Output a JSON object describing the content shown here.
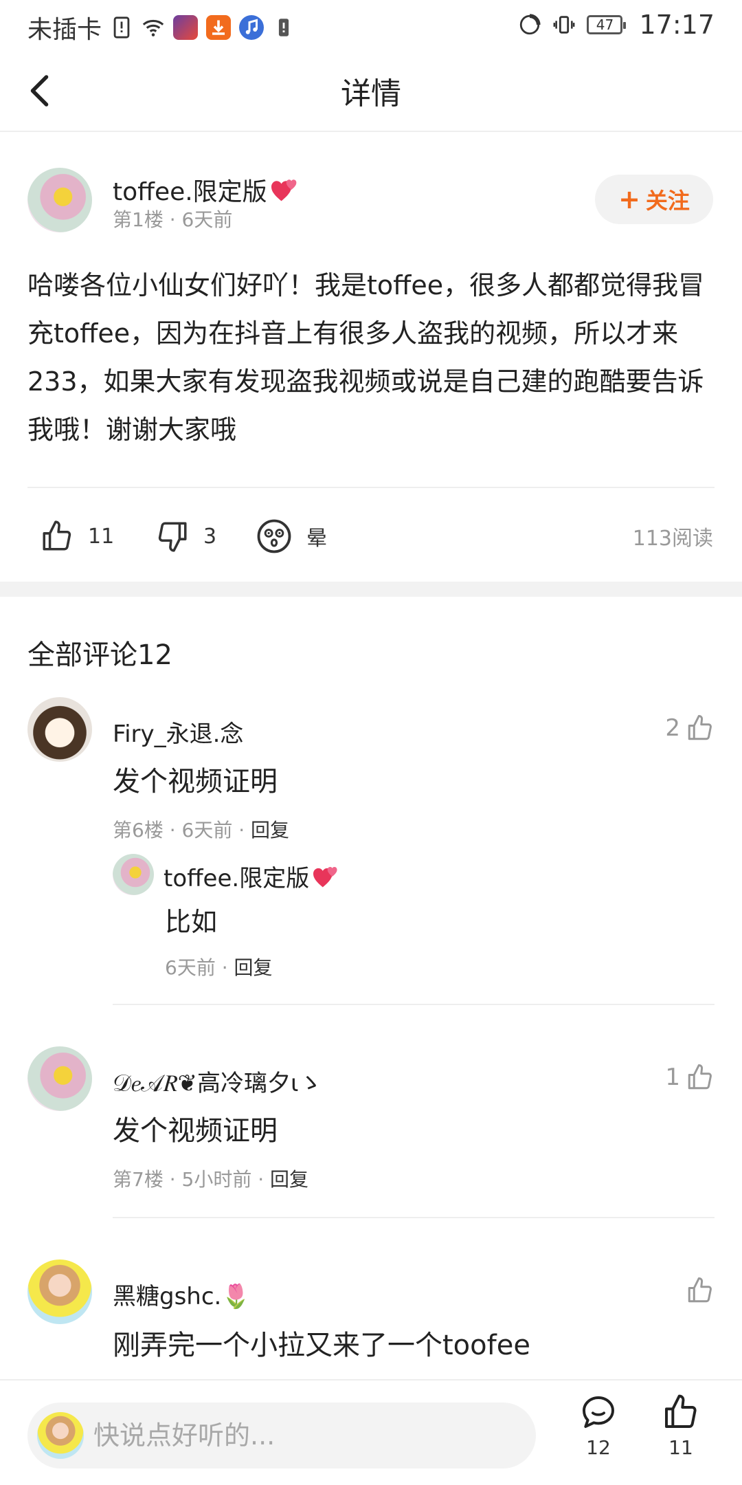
{
  "status_bar": {
    "carrier": "未插卡",
    "battery": "47",
    "time": "17:17"
  },
  "nav": {
    "title": "详情"
  },
  "post": {
    "author": "toffee.限定版",
    "meta": "第1楼 · 6天前",
    "follow_label": "关注",
    "text": "哈喽各位小仙女们好吖！我是toffee，很多人都都觉得我冒充toffee，因为在抖音上有很多人盗我的视频，所以才来233，如果大家有发现盗我视频或说是自己建的跑酷要告诉我哦！谢谢大家哦",
    "likes": "11",
    "dislikes": "3",
    "reaction_label": "晕",
    "reads": "113阅读"
  },
  "comments_section": {
    "title": "全部评论12"
  },
  "comments": [
    {
      "name": "Firy_永退.念",
      "text": "发个视频证明",
      "floor": "第6楼 · 6天前 ·",
      "reply_label": "回复",
      "likes": "2",
      "reply": {
        "name": "toffee.限定版",
        "text": "比如",
        "meta": "6天前 ·",
        "reply_label": "回复"
      }
    },
    {
      "name": "𝒟𝑒𝒜𝑅❦高冷璃夕ιゝ",
      "text": "发个视频证明",
      "floor": "第7楼 · 5小时前 ·",
      "reply_label": "回复",
      "likes": "1"
    },
    {
      "name": "黑糖gshc.🌷",
      "text": "刚弄完一个小拉又来了一个toofee",
      "likes": ""
    }
  ],
  "bottom_bar": {
    "input_placeholder": "快说点好听的...",
    "comment_count": "12",
    "like_count": "11"
  },
  "colors": {
    "accent": "#f26b1d",
    "meta_gray": "#999999",
    "band_gray": "#f2f2f2"
  }
}
